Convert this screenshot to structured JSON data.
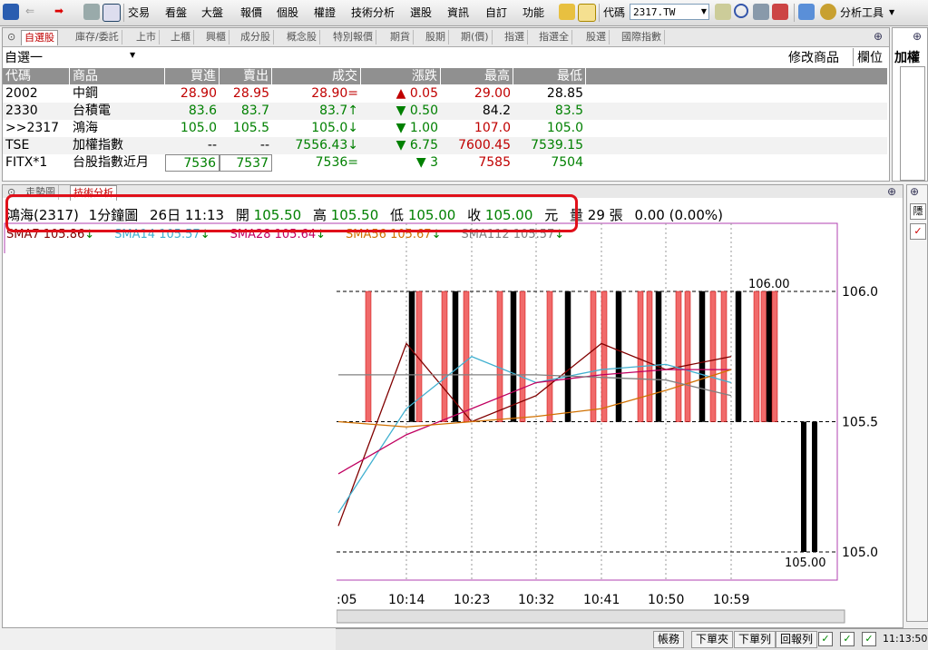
{
  "toolbar": {
    "menus": [
      "交易",
      "看盤",
      "大盤",
      "報價",
      "個股",
      "權證",
      "技術分析",
      "選股",
      "資訊",
      "自訂",
      "功能"
    ],
    "code_label": "代碼",
    "code_value": "2317.TW",
    "analysis_tools": "分析工具"
  },
  "quote": {
    "tabs": [
      "自選股",
      "庫存/委託",
      "上市",
      "上櫃",
      "興櫃",
      "成分股",
      "概念股",
      "特別報價",
      "期貨",
      "股期",
      "期(價)",
      "指選",
      "指選全",
      "股選",
      "國際指數"
    ],
    "list_name": "自選一",
    "modify_label": "修改商品",
    "column_label": "欄位",
    "side_label": "加權",
    "headers": [
      "代碼",
      "商品",
      "買進",
      "賣出",
      "成交",
      "漲跌",
      "最高",
      "最低"
    ],
    "rows": [
      {
        "code": "2002",
        "name": "中鋼",
        "bid": "28.90",
        "ask": "28.95",
        "last": "28.90",
        "last_mark": "=",
        "change": "0.05",
        "change_dir": "▲",
        "high": "29.00",
        "low": "28.85",
        "bid_c": "red",
        "ask_c": "red",
        "last_c": "red",
        "chg_c": "red",
        "high_c": "red",
        "low_c": "black"
      },
      {
        "code": "2330",
        "name": "台積電",
        "bid": "83.6",
        "ask": "83.7",
        "last": "83.7",
        "last_mark": "↑",
        "change": "0.50",
        "change_dir": "▼",
        "high": "84.2",
        "low": "83.5",
        "bid_c": "green",
        "ask_c": "green",
        "last_c": "green",
        "chg_c": "green",
        "high_c": "black",
        "low_c": "green"
      },
      {
        "code": ">>2317",
        "name": "鴻海",
        "bid": "105.0",
        "ask": "105.5",
        "last": "105.0",
        "last_mark": "↓",
        "change": "1.00",
        "change_dir": "▼",
        "high": "107.0",
        "low": "105.0",
        "bid_c": "green",
        "ask_c": "green",
        "last_c": "green",
        "chg_c": "green",
        "high_c": "red",
        "low_c": "green"
      },
      {
        "code": "TSE",
        "name": "加權指數",
        "bid": "--",
        "ask": "--",
        "last": "7556.43",
        "last_mark": "↓",
        "change": "6.75",
        "change_dir": "▼",
        "high": "7600.45",
        "low": "7539.15",
        "bid_c": "black",
        "ask_c": "black",
        "last_c": "green",
        "chg_c": "green",
        "high_c": "red",
        "low_c": "green"
      },
      {
        "code": "FITX*1",
        "name": "台股指數近月",
        "bid": "7536",
        "ask": "7537",
        "last": "7536",
        "last_mark": "=",
        "change": "3",
        "change_dir": "▼",
        "high": "7585",
        "low": "7504",
        "bid_c": "green",
        "ask_c": "green",
        "last_c": "green",
        "chg_c": "green",
        "high_c": "red",
        "low_c": "green"
      }
    ]
  },
  "chart": {
    "tabs": [
      "走勢圖",
      "技術分析"
    ],
    "info": {
      "stock": "鴻海(2317)",
      "period": "1分鐘圖",
      "datetime": "26日 11:13",
      "open_label": "開",
      "open": "105.50",
      "high_label": "高",
      "high": "105.50",
      "low_label": "低",
      "low": "105.00",
      "close_label": "收",
      "close": "105.00",
      "unit": "元",
      "volume_label": "量",
      "volume": "29",
      "volume_unit": "張",
      "change": "0.00",
      "change_pct": "(0.00%)"
    },
    "sma": [
      {
        "label": "SMA7",
        "value": "105.86",
        "color": "#800000"
      },
      {
        "label": "SMA14",
        "value": "105.57",
        "color": "#40b0d0"
      },
      {
        "label": "SMA28",
        "value": "105.64",
        "color": "#c00060"
      },
      {
        "label": "SMA56",
        "value": "105.67",
        "color": "#d07000"
      },
      {
        "label": "SMA112",
        "value": "105.57",
        "color": "#808080"
      }
    ],
    "y_ticks": [
      "106.0",
      "105.5",
      "105.0"
    ],
    "x_ticks": [
      ":05",
      "10:14",
      "10:23",
      "10:32",
      "10:41",
      "10:50",
      "10:59"
    ],
    "max_label": "106.00",
    "min_label": "105.00",
    "side_label": "隱"
  },
  "chart_data": {
    "type": "line",
    "ylim": [
      105.0,
      106.0
    ],
    "x": [
      ":05",
      "10:14",
      "10:23",
      "10:32",
      "10:41",
      "10:50",
      "10:59"
    ],
    "series": [
      {
        "name": "SMA7",
        "values": [
          105.1,
          105.8,
          105.5,
          105.6,
          105.8,
          105.7,
          105.75
        ]
      },
      {
        "name": "SMA14",
        "values": [
          105.15,
          105.55,
          105.75,
          105.65,
          105.7,
          105.72,
          105.65
        ]
      },
      {
        "name": "SMA28",
        "values": [
          105.3,
          105.45,
          105.55,
          105.65,
          105.68,
          105.7,
          105.7
        ]
      },
      {
        "name": "SMA56",
        "values": [
          105.5,
          105.48,
          105.5,
          105.52,
          105.55,
          105.62,
          105.7
        ]
      },
      {
        "name": "SMA112",
        "values": [
          105.68,
          105.68,
          105.68,
          105.68,
          105.67,
          105.66,
          105.6
        ]
      }
    ]
  },
  "status": {
    "buttons": [
      "帳務",
      "下單夾",
      "下單列",
      "回報列"
    ],
    "clock": "11:13:50"
  }
}
